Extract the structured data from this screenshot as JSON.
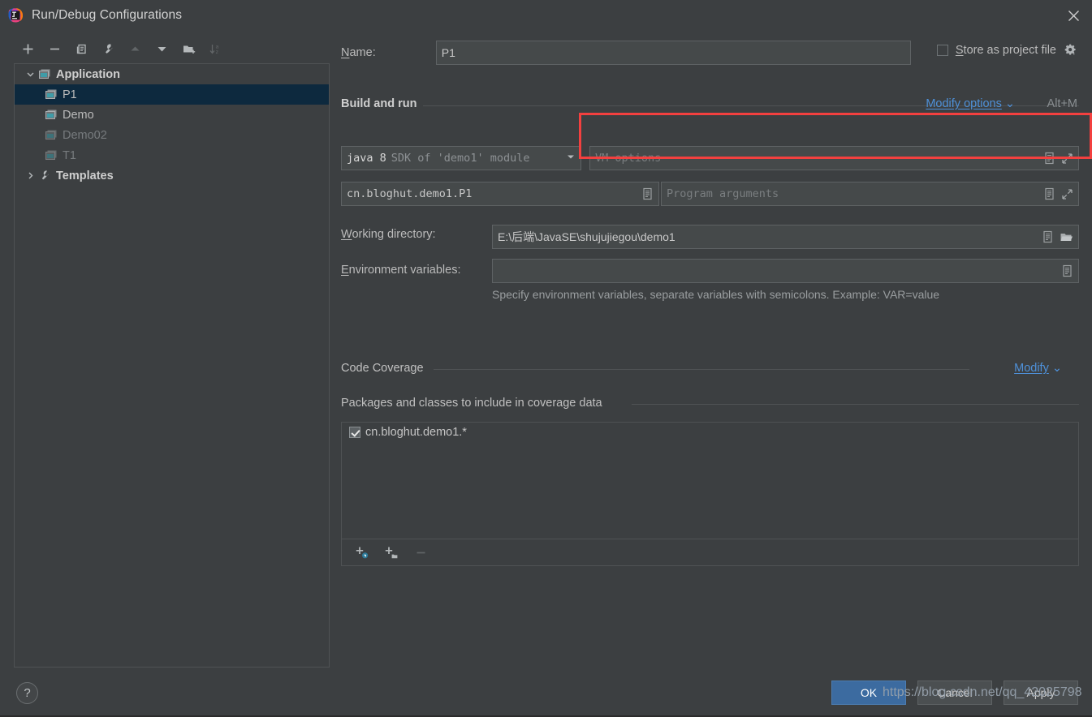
{
  "window": {
    "title": "Run/Debug Configurations",
    "app_icon": "intellij-idea-logo",
    "close_icon": "close-icon"
  },
  "toolbar": {
    "buttons": [
      {
        "name": "add-configuration-button",
        "icon": "plus-icon",
        "tooltip": "Add New Configuration",
        "disabled": false
      },
      {
        "name": "remove-configuration-button",
        "icon": "minus-icon",
        "tooltip": "Remove Configuration",
        "disabled": false
      },
      {
        "name": "copy-configuration-button",
        "icon": "copy-icon",
        "tooltip": "Copy Configuration",
        "disabled": false
      },
      {
        "name": "edit-templates-button",
        "icon": "wrench-icon",
        "tooltip": "Edit Templates",
        "disabled": false
      },
      {
        "name": "move-up-button",
        "icon": "arrow-up-icon",
        "tooltip": "Move Up",
        "disabled": true
      },
      {
        "name": "move-down-button",
        "icon": "arrow-down-icon",
        "tooltip": "Move Down",
        "disabled": false
      },
      {
        "name": "new-folder-button",
        "icon": "new-folder-icon",
        "tooltip": "Create New Folder",
        "disabled": false
      },
      {
        "name": "sort-configurations-button",
        "icon": "sort-az-icon",
        "tooltip": "Sort Configurations",
        "disabled": true
      }
    ]
  },
  "sidebar": {
    "items": [
      {
        "label": "Application",
        "icon": "application-icon",
        "level": 0,
        "twisty": "chevron-down-icon",
        "bold": true,
        "selected": false,
        "dim": false
      },
      {
        "label": "P1",
        "icon": "application-icon",
        "level": 1,
        "twisty": "",
        "bold": false,
        "selected": true,
        "dim": false
      },
      {
        "label": "Demo",
        "icon": "application-icon",
        "level": 1,
        "twisty": "",
        "bold": false,
        "selected": false,
        "dim": false
      },
      {
        "label": "Demo02",
        "icon": "application-icon",
        "level": 1,
        "twisty": "",
        "bold": false,
        "selected": false,
        "dim": true
      },
      {
        "label": "T1",
        "icon": "application-icon",
        "level": 1,
        "twisty": "",
        "bold": false,
        "selected": false,
        "dim": true
      },
      {
        "label": "Templates",
        "icon": "wrench-icon",
        "level": 0,
        "twisty": "chevron-right-icon",
        "bold": true,
        "selected": false,
        "dim": false
      }
    ]
  },
  "form": {
    "name_label": "Name:",
    "name_mnemonic": "N",
    "name_value": "P1",
    "store_as_project_file_label": "Store as project file",
    "store_as_project_file_mnemonic": "S",
    "store_as_project_file_checked": false,
    "store_gear_icon": "gear-dropdown-icon"
  },
  "build_and_run": {
    "section_title": "Build and run",
    "modify_options_label": "Modify options",
    "modify_options_shortcut": "Alt+M",
    "sdk_primary": "java 8",
    "sdk_secondary": "SDK of 'demo1' module",
    "sdk_dropdown_icon": "chevron-down-icon",
    "vm_options_placeholder": "VM options",
    "vm_options_value": "",
    "main_class_value": "cn.bloghut.demo1.P1",
    "program_arguments_placeholder": "Program arguments",
    "program_arguments_value": "",
    "macro_icon": "macro-document-icon",
    "expand_icon": "expand-arrows-icon"
  },
  "directories": {
    "working_directory_label": "Working directory:",
    "working_directory_mnemonic": "W",
    "working_directory_value": "E:\\后端\\JavaSE\\shujujiegou\\demo1",
    "working_directory_browse_icon": "folder-open-icon",
    "environment_variables_label": "Environment variables:",
    "environment_variables_mnemonic": "E",
    "environment_variables_value": "",
    "environment_variables_hint": "Specify environment variables, separate variables with semicolons. Example: VAR=value",
    "macro_icon": "macro-document-icon"
  },
  "code_coverage": {
    "section_title": "Code Coverage",
    "modify_label": "Modify",
    "modify_chevron_icon": "chevron-down-icon",
    "packages_title": "Packages and classes to include in coverage data",
    "entries": [
      {
        "label": "cn.bloghut.demo1.*",
        "checked": true
      }
    ],
    "list_buttons": [
      {
        "name": "add-class-button",
        "icon": "add-class-icon",
        "disabled": false
      },
      {
        "name": "add-package-button",
        "icon": "add-package-icon",
        "disabled": false
      },
      {
        "name": "remove-entry-button",
        "icon": "minus-icon",
        "disabled": true
      }
    ]
  },
  "footer": {
    "help_label": "?",
    "ok_label": "OK",
    "cancel_label": "Cancel",
    "apply_label": "Apply"
  },
  "annotation": {
    "highlight_color": "#f3403f",
    "highlight_target": "vm-options-field",
    "watermark_text": "https://blog.csdn.net/qq_42025798"
  },
  "colors": {
    "background": "#3c3f41",
    "field_background": "#45494a",
    "selection": "#0d293e",
    "link": "#4e90d8",
    "primary_button": "#3c6ba0",
    "text": "#bbbbbb",
    "text_dim": "#777b7e"
  }
}
